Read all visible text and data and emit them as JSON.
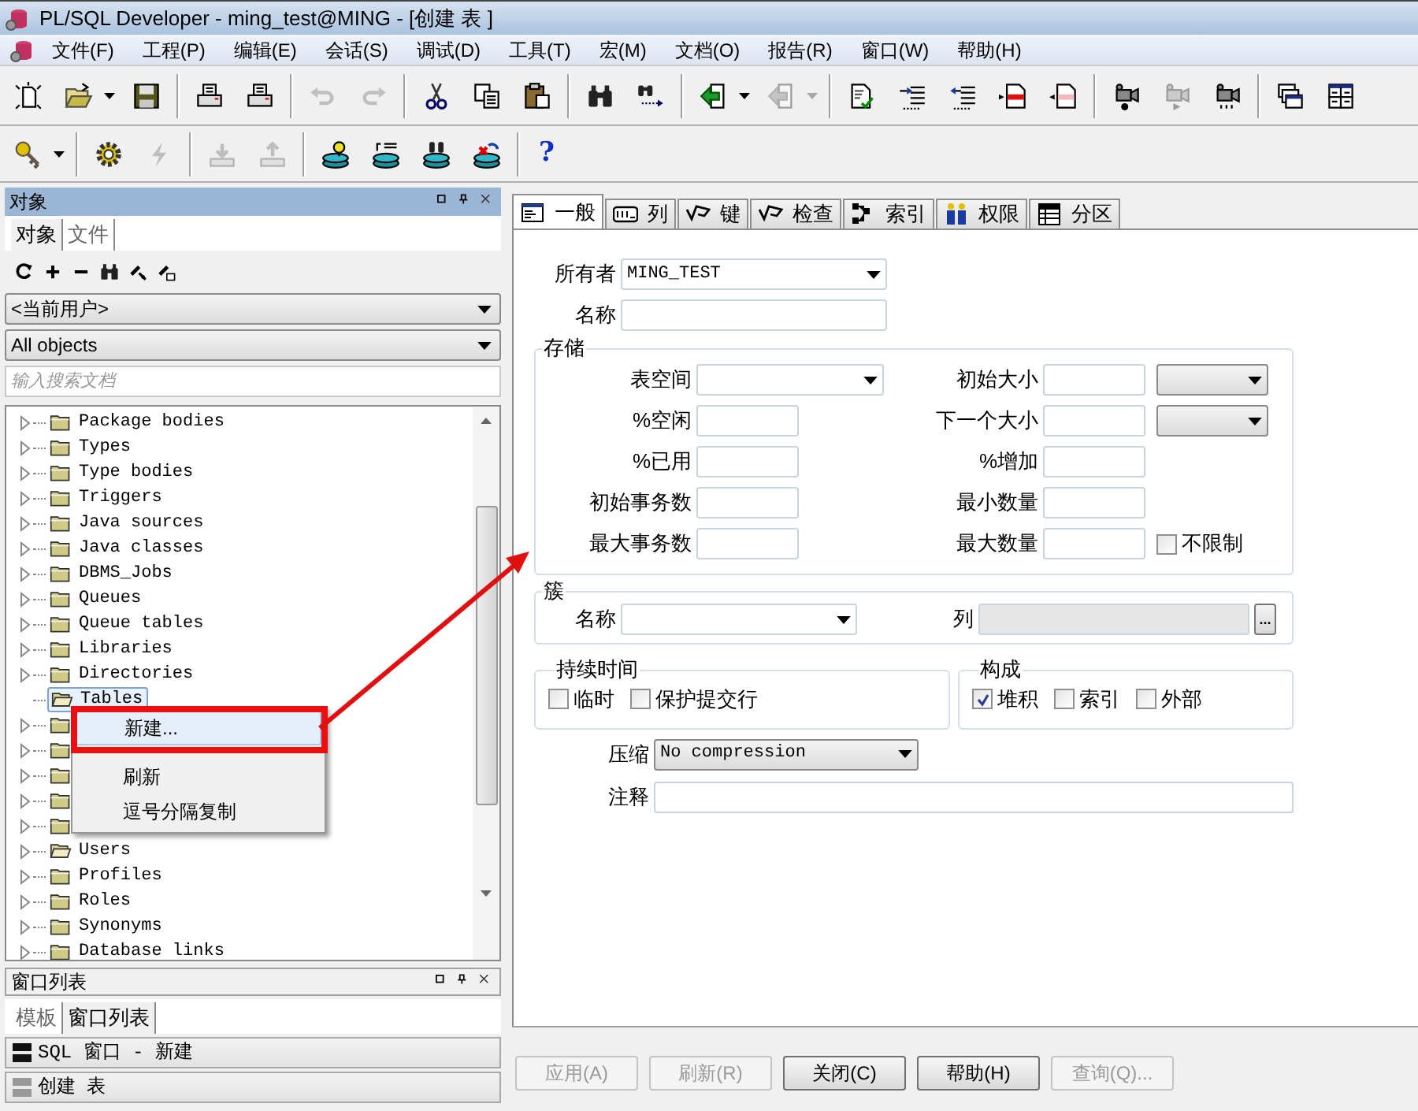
{
  "window": {
    "title": "PL/SQL Developer - ming_test@MING - [创建 表 ]"
  },
  "menu": [
    "文件(F)",
    "工程(P)",
    "编辑(E)",
    "会话(S)",
    "调试(D)",
    "工具(T)",
    "宏(M)",
    "文档(O)",
    "报告(R)",
    "窗口(W)",
    "帮助(H)"
  ],
  "toolbar_1": [
    {
      "items": [
        {
          "kind": "new",
          "disabled": false,
          "dropdown": false
        },
        {
          "kind": "open",
          "disabled": false,
          "dropdown": true
        },
        {
          "kind": "save",
          "disabled": false,
          "dropdown": false
        }
      ]
    },
    {
      "items": [
        {
          "kind": "print",
          "disabled": false,
          "dropdown": false
        },
        {
          "kind": "print",
          "disabled": false,
          "dropdown": false
        }
      ]
    },
    {
      "items": [
        {
          "kind": "undo",
          "disabled": true,
          "dropdown": false
        },
        {
          "kind": "redo",
          "disabled": true,
          "dropdown": false
        }
      ]
    },
    {
      "items": [
        {
          "kind": "cut",
          "disabled": false,
          "dropdown": false
        },
        {
          "kind": "copy",
          "disabled": false,
          "dropdown": false
        },
        {
          "kind": "paste",
          "disabled": false,
          "dropdown": false
        }
      ]
    },
    {
      "items": [
        {
          "kind": "find",
          "disabled": false,
          "dropdown": false
        },
        {
          "kind": "find-next",
          "disabled": false,
          "dropdown": false
        }
      ]
    },
    {
      "items": [
        {
          "kind": "run",
          "disabled": false,
          "dropdown": true
        },
        {
          "kind": "run",
          "disabled": true,
          "dropdown": true
        }
      ]
    },
    {
      "items": [
        {
          "kind": "doc-check",
          "disabled": false,
          "dropdown": false
        },
        {
          "kind": "indent",
          "disabled": false,
          "dropdown": false
        },
        {
          "kind": "outdent",
          "disabled": false,
          "dropdown": false
        },
        {
          "kind": "doc-add",
          "disabled": false,
          "dropdown": false
        },
        {
          "kind": "doc-remove",
          "disabled": false,
          "dropdown": false
        }
      ]
    },
    {
      "items": [
        {
          "kind": "macro-record",
          "disabled": false,
          "dropdown": false
        },
        {
          "kind": "macro-play",
          "disabled": true,
          "dropdown": false
        },
        {
          "kind": "macro-list",
          "disabled": false,
          "dropdown": false
        }
      ]
    },
    {
      "items": [
        {
          "kind": "cascade",
          "disabled": false,
          "dropdown": false
        },
        {
          "kind": "tile",
          "disabled": false,
          "dropdown": false
        }
      ]
    }
  ],
  "toolbar_2": [
    {
      "items": [
        {
          "kind": "key",
          "disabled": false,
          "dropdown": true
        }
      ]
    },
    {
      "items": [
        {
          "kind": "gear",
          "disabled": false,
          "dropdown": false
        },
        {
          "kind": "lightning",
          "disabled": true,
          "dropdown": false
        }
      ]
    },
    {
      "items": [
        {
          "kind": "tray-down",
          "disabled": true,
          "dropdown": false
        },
        {
          "kind": "tray-up",
          "disabled": true,
          "dropdown": false
        }
      ]
    },
    {
      "items": [
        {
          "kind": "db-bulb",
          "disabled": false,
          "dropdown": false
        },
        {
          "kind": "db-sql",
          "disabled": false,
          "dropdown": false
        },
        {
          "kind": "db-find",
          "disabled": false,
          "dropdown": false
        },
        {
          "kind": "db-cross",
          "disabled": false,
          "dropdown": false
        }
      ]
    },
    {
      "items": [
        {
          "kind": "help",
          "glyph": "?",
          "disabled": false,
          "dropdown": false
        }
      ]
    }
  ],
  "object_panel": {
    "title": "对象",
    "tabs": [
      {
        "label": "对象",
        "selected": true
      },
      {
        "label": "文件",
        "selected": false
      }
    ],
    "owner_select": "<当前用户>",
    "type_select": "All objects",
    "search": {
      "placeholder": "输入搜索文档"
    },
    "tree": [
      {
        "label": "Package bodies",
        "open": false,
        "selected": false,
        "expander": true
      },
      {
        "label": "Types",
        "open": false,
        "selected": false,
        "expander": true
      },
      {
        "label": "Type bodies",
        "open": false,
        "selected": false,
        "expander": true
      },
      {
        "label": "Triggers",
        "open": false,
        "selected": false,
        "expander": true
      },
      {
        "label": "Java sources",
        "open": false,
        "selected": false,
        "expander": true
      },
      {
        "label": "Java classes",
        "open": false,
        "selected": false,
        "expander": true
      },
      {
        "label": "DBMS_Jobs",
        "open": false,
        "selected": false,
        "expander": true
      },
      {
        "label": "Queues",
        "open": false,
        "selected": false,
        "expander": true
      },
      {
        "label": "Queue tables",
        "open": false,
        "selected": false,
        "expander": true
      },
      {
        "label": "Libraries",
        "open": false,
        "selected": false,
        "expander": true
      },
      {
        "label": "Directories",
        "open": false,
        "selected": false,
        "expander": true
      },
      {
        "label": "Tables",
        "open": true,
        "selected": true,
        "expander": false
      },
      {
        "open": false,
        "selected": false,
        "expander": true
      },
      {
        "open": false,
        "selected": false,
        "expander": true
      },
      {
        "open": false,
        "selected": false,
        "expander": true
      },
      {
        "open": false,
        "selected": false,
        "expander": true
      },
      {
        "open": false,
        "selected": false,
        "expander": true
      },
      {
        "label": "Users",
        "open": true,
        "selected": false,
        "expander": true
      },
      {
        "label": "Profiles",
        "open": false,
        "selected": false,
        "expander": true
      },
      {
        "label": "Roles",
        "open": false,
        "selected": false,
        "expander": true
      },
      {
        "label": "Synonyms",
        "open": false,
        "selected": false,
        "expander": true
      },
      {
        "label": "Database links",
        "open": false,
        "selected": false,
        "expander": true
      }
    ]
  },
  "context_menu": {
    "items": [
      {
        "label": "新建...",
        "selected": true,
        "separator_after": true
      },
      {
        "label": "刷新",
        "selected": false,
        "separator_after": false
      },
      {
        "label": "逗号分隔复制",
        "selected": false,
        "separator_after": false
      }
    ]
  },
  "window_list": {
    "title": "窗口列表",
    "tabs": [
      {
        "label": "模板",
        "selected": false
      },
      {
        "label": "窗口列表",
        "selected": true
      }
    ],
    "items": [
      {
        "label": "SQL 窗口 - 新建",
        "selected": true
      },
      {
        "label": "创建 表",
        "selected": false
      }
    ]
  },
  "editor": {
    "tabs": [
      {
        "kind": "general",
        "label": "一般",
        "selected": true
      },
      {
        "kind": "columns",
        "label": "列",
        "selected": false
      },
      {
        "kind": "keys",
        "label": "键",
        "selected": false
      },
      {
        "kind": "checks",
        "label": "检查",
        "selected": false
      },
      {
        "kind": "indexes",
        "label": "索引",
        "selected": false
      },
      {
        "kind": "privileges",
        "label": "权限",
        "selected": false
      },
      {
        "kind": "partitions",
        "label": "分区",
        "selected": false
      }
    ],
    "owner": {
      "label": "所有者",
      "value": "MING_TEST"
    },
    "name": {
      "label": "名称"
    },
    "storage": {
      "title": "存储",
      "rows": [
        {
          "left": {
            "label": "表空间",
            "kind": "select"
          },
          "right": {
            "label": "初始大小",
            "kind": "input-unit"
          }
        },
        {
          "left": {
            "label": "%空闲",
            "kind": "input"
          },
          "right": {
            "label": "下一个大小",
            "kind": "input-unit"
          }
        },
        {
          "left": {
            "label": "%已用",
            "kind": "input"
          },
          "right": {
            "label": "%增加",
            "kind": "input"
          }
        },
        {
          "left": {
            "label": "初始事务数",
            "kind": "input"
          },
          "right": {
            "label": "最小数量",
            "kind": "input"
          }
        },
        {
          "left": {
            "label": "最大事务数",
            "kind": "input"
          },
          "right": {
            "label": "最大数量",
            "kind": "input-check",
            "check_label": "不限制",
            "checked": false
          }
        }
      ]
    },
    "cluster": {
      "title": "簇",
      "name_label": "名称",
      "columns_label": "列",
      "browse_button": "..."
    },
    "duration": {
      "title": "持续时间",
      "options": [
        {
          "label": "临时",
          "checked": false
        },
        {
          "label": "保护提交行",
          "checked": false
        }
      ]
    },
    "organization": {
      "title": "构成",
      "options": [
        {
          "label": "堆积",
          "checked": true
        },
        {
          "label": "索引",
          "checked": false
        },
        {
          "label": "外部",
          "checked": false
        }
      ]
    },
    "compression": {
      "label": "压缩",
      "value": "No compression"
    },
    "comment": {
      "label": "注释"
    },
    "buttons": [
      {
        "label": "应用(A)",
        "disabled": true
      },
      {
        "label": "刷新(R)",
        "disabled": true
      },
      {
        "label": "关闭(C)",
        "disabled": false
      },
      {
        "label": "帮助(H)",
        "disabled": false
      },
      {
        "label": "查询(Q)...",
        "disabled": true
      }
    ]
  }
}
